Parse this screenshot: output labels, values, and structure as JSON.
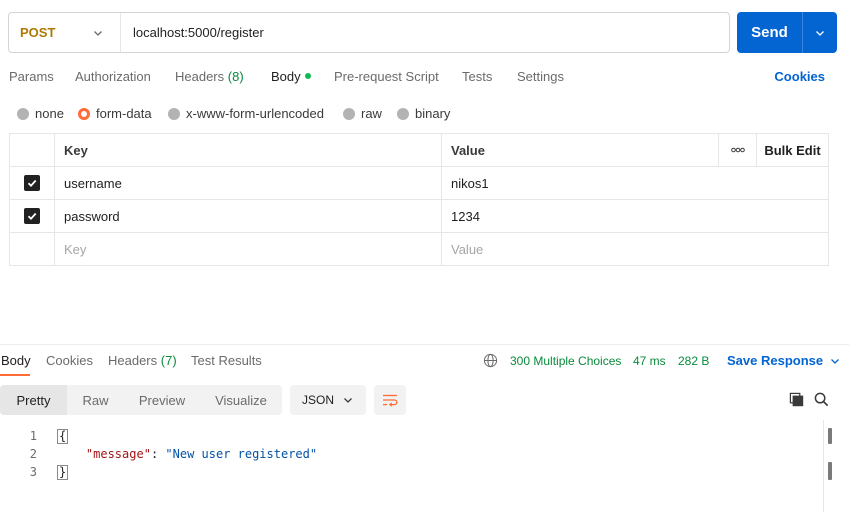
{
  "request": {
    "method": "POST",
    "url": "localhost:5000/register",
    "send_label": "Send"
  },
  "req_tabs": {
    "params": "Params",
    "authorization": "Authorization",
    "headers": "Headers",
    "headers_count": "(8)",
    "body": "Body",
    "prerequest": "Pre-request Script",
    "tests": "Tests",
    "settings": "Settings",
    "cookies": "Cookies"
  },
  "body_types": [
    "none",
    "form-data",
    "x-www-form-urlencoded",
    "raw",
    "binary"
  ],
  "body_type_selected": "form-data",
  "form_table": {
    "key_header": "Key",
    "value_header": "Value",
    "more_label": "ooo",
    "bulk_edit": "Bulk Edit",
    "rows": [
      {
        "checked": true,
        "key": "username",
        "value": "nikos1"
      },
      {
        "checked": true,
        "key": "password",
        "value": "1234"
      }
    ],
    "key_placeholder": "Key",
    "value_placeholder": "Value"
  },
  "response": {
    "tabs": {
      "body": "Body",
      "cookies": "Cookies",
      "headers": "Headers",
      "headers_count": "(7)",
      "test_results": "Test Results"
    },
    "status": "300 Multiple Choices",
    "time": "47 ms",
    "size": "282 B",
    "save_response": "Save Response",
    "views": {
      "pretty": "Pretty",
      "raw": "Raw",
      "preview": "Preview",
      "visualize": "Visualize"
    },
    "format": "JSON",
    "code_lines": [
      {
        "n": "1",
        "text": "{"
      },
      {
        "n": "2",
        "key": "\"message\"",
        "sep": ": ",
        "val": "\"New user registered\""
      },
      {
        "n": "3",
        "text": "}"
      }
    ]
  },
  "colors": {
    "accent_blue": "#0265d2",
    "accent_orange": "#ff6c37",
    "method_post": "#ad7a03",
    "status_green": "#0a8a3c"
  }
}
